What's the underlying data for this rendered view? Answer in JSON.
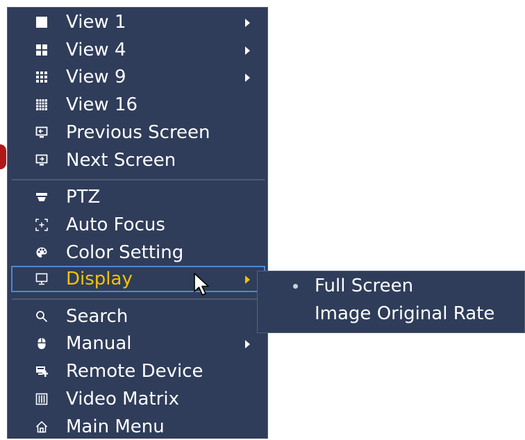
{
  "menu": {
    "items": [
      {
        "label": "View 1",
        "icon": "single-view-icon",
        "submenu": true
      },
      {
        "label": "View 4",
        "icon": "quad-view-icon",
        "submenu": true
      },
      {
        "label": "View 9",
        "icon": "nine-view-icon",
        "submenu": true
      },
      {
        "label": "View 16",
        "icon": "sixteen-view-icon",
        "submenu": false
      },
      {
        "label": "Previous Screen",
        "icon": "previous-screen-icon",
        "submenu": false
      },
      {
        "label": "Next Screen",
        "icon": "next-screen-icon",
        "submenu": false
      },
      {
        "label": "PTZ",
        "icon": "ptz-camera-icon",
        "submenu": false
      },
      {
        "label": "Auto Focus",
        "icon": "auto-focus-icon",
        "submenu": false
      },
      {
        "label": "Color Setting",
        "icon": "color-palette-icon",
        "submenu": false
      },
      {
        "label": "Display",
        "icon": "monitor-icon",
        "submenu": true,
        "selected": true
      },
      {
        "label": "Search",
        "icon": "search-icon",
        "submenu": false
      },
      {
        "label": "Manual",
        "icon": "mouse-icon",
        "submenu": true
      },
      {
        "label": "Remote Device",
        "icon": "remote-device-icon",
        "submenu": false
      },
      {
        "label": "Video Matrix",
        "icon": "video-matrix-icon",
        "submenu": false
      },
      {
        "label": "Main Menu",
        "icon": "home-icon",
        "submenu": false
      }
    ]
  },
  "display_submenu": {
    "items": [
      {
        "label": "Full Screen",
        "checked": true
      },
      {
        "label": "Image Original Rate",
        "checked": false
      }
    ]
  },
  "colors": {
    "menu_bg": "#2f3d5a",
    "text": "#ffffff",
    "selected_text": "#f2c400",
    "selected_border": "#4f86d6"
  }
}
